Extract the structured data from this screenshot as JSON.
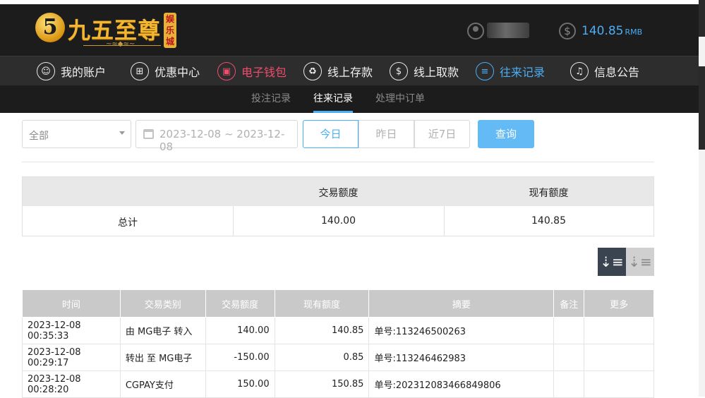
{
  "brand": {
    "logo_mark": "5",
    "name": "九五至尊",
    "badge": "娱乐城"
  },
  "account": {
    "balance": "140.85",
    "currency": "RMB"
  },
  "nav": [
    {
      "label": "我的账户",
      "icon": "user-icon"
    },
    {
      "label": "优惠中心",
      "icon": "gift-icon"
    },
    {
      "label": "电子钱包",
      "icon": "wallet-icon"
    },
    {
      "label": "线上存款",
      "icon": "deposit-icon"
    },
    {
      "label": "线上取款",
      "icon": "withdraw-icon"
    },
    {
      "label": "往来记录",
      "icon": "records-icon"
    },
    {
      "label": "信息公告",
      "icon": "bell-icon"
    }
  ],
  "subtabs": [
    {
      "label": "投注记录"
    },
    {
      "label": "往来记录"
    },
    {
      "label": "处理中订单"
    }
  ],
  "filters": {
    "type_selected": "全部",
    "date_range": "2023-12-08 ~ 2023-12-08",
    "quick": [
      "今日",
      "昨日",
      "近7日"
    ],
    "query_label": "查询"
  },
  "summary": {
    "headers": [
      "",
      "交易额度",
      "现有额度"
    ],
    "row_label": "总计",
    "transaction_amount": "140.00",
    "current_amount": "140.85"
  },
  "table": {
    "headers": [
      "时间",
      "交易类别",
      "交易额度",
      "现有额度",
      "摘要",
      "备注",
      "更多"
    ],
    "rows": [
      [
        "2023-12-08 00:35:33",
        "由 MG电子 转入",
        "140.00",
        "140.85",
        "单号:113246500263",
        "",
        ""
      ],
      [
        "2023-12-08 00:29:17",
        "转出 至 MG电子",
        "-150.00",
        "0.85",
        "单号:113246462983",
        "",
        ""
      ],
      [
        "2023-12-08 00:28:20",
        "CGPAY支付",
        "150.00",
        "150.85",
        "单号:202312083466849806",
        "",
        ""
      ]
    ]
  },
  "colors": {
    "accent": "#4aaef5",
    "wallet_pink": "#ef4d6c",
    "header_bg": "#1c1c1c"
  }
}
